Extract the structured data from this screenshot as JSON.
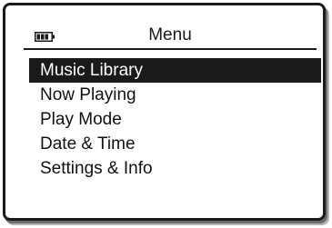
{
  "header": {
    "title": "Menu",
    "battery_icon": "battery-icon"
  },
  "menu": {
    "selected_index": 0,
    "items": [
      {
        "label": "Music Library"
      },
      {
        "label": "Now Playing"
      },
      {
        "label": "Play Mode"
      },
      {
        "label": "Date & Time"
      },
      {
        "label": "Settings & Info"
      }
    ]
  },
  "colors": {
    "frame": "#1a1a1a",
    "screen_bg": "#ffffff",
    "highlight_bg": "#1a1a1a",
    "highlight_text": "#ffffff",
    "text": "#111111"
  }
}
